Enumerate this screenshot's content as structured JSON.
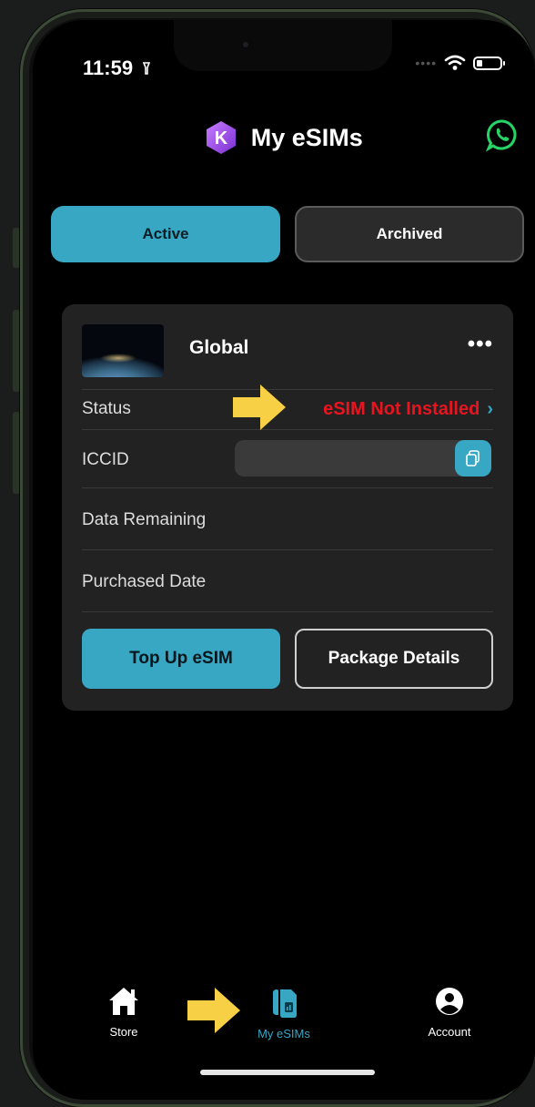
{
  "status_bar": {
    "time": "11:59"
  },
  "header": {
    "title": "My eSIMs",
    "logo_letter": "K"
  },
  "tabs": [
    {
      "label": "Active",
      "active": true
    },
    {
      "label": "Archived",
      "active": false
    }
  ],
  "card": {
    "title": "Global",
    "more_label": "•••",
    "rows": {
      "status_label": "Status",
      "status_value": "eSIM Not Installed",
      "iccid_label": "ICCID",
      "data_remaining_label": "Data Remaining",
      "purchased_date_label": "Purchased Date"
    },
    "buttons": {
      "top_up": "Top Up eSIM",
      "package_details": "Package Details"
    }
  },
  "nav": {
    "store": "Store",
    "my_esims": "My eSIMs",
    "account": "Account"
  },
  "colors": {
    "accent": "#37a7c4",
    "status_error": "#e8141f",
    "whatsapp": "#25d366",
    "highlight_arrow": "#f7d046"
  },
  "icons": [
    "signal-icon",
    "wifi-icon",
    "battery-icon",
    "logo-icon",
    "whatsapp-icon",
    "more-icon",
    "chevron-right-icon",
    "copy-icon",
    "home-icon",
    "sim-card-icon",
    "account-icon",
    "pointer-arrow-icon"
  ]
}
